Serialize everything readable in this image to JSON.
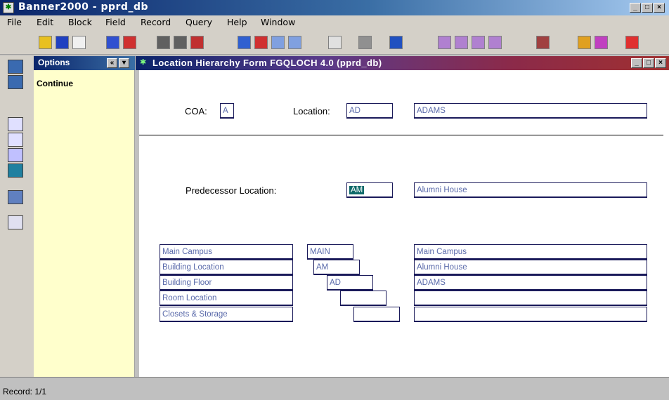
{
  "window": {
    "title": "Banner2000 - pprd_db"
  },
  "menu": [
    "File",
    "Edit",
    "Block",
    "Field",
    "Record",
    "Query",
    "Help",
    "Window"
  ],
  "toolbar_icons": [
    "save-icon",
    "rollback-icon",
    "exit-icon",
    "insert-record-icon",
    "remove-record-icon",
    "print-icon",
    "print-preview-icon",
    "delete-icon",
    "next-block-icon",
    "previous-block-icon",
    "copy-icon",
    "paste-icon",
    "edit-icon",
    "print-form-icon",
    "chart-icon",
    "query-icon",
    "enter-query-icon",
    "execute-query-icon",
    "cancel-query-icon",
    "calendar-icon",
    "help-icon",
    "bookmark-icon",
    "exit-form-icon"
  ],
  "options": {
    "title": "Options",
    "items": [
      "Continue"
    ]
  },
  "form": {
    "title": "Location Hierarchy Form  FGQLOCH  4.0  (pprd_db)",
    "coa_label": "COA:",
    "coa_value": "A",
    "location_label": "Location:",
    "location_code": "AD",
    "location_desc": "ADAMS",
    "predecessor_label": "Predecessor Location:",
    "predecessor_code": "AM",
    "predecessor_desc": "Alumni House",
    "hierarchy": [
      {
        "level": "Main Campus",
        "code": "MAIN",
        "desc": "Main Campus"
      },
      {
        "level": "Building Location",
        "code": "AM",
        "desc": "Alumni House"
      },
      {
        "level": "Building Floor",
        "code": "AD",
        "desc": "ADAMS"
      },
      {
        "level": "Room Location",
        "code": "",
        "desc": ""
      },
      {
        "level": "Closets & Storage",
        "code": "",
        "desc": ""
      }
    ]
  },
  "status": {
    "record": "Record: 1/1"
  }
}
